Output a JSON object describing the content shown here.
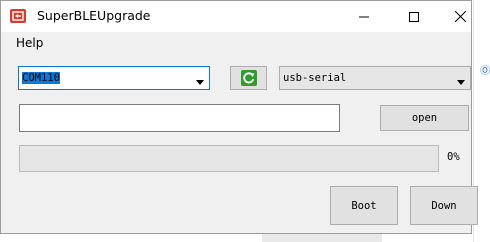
{
  "window": {
    "title": "SuperBLEUpgrade",
    "icon": "app-logo-icon",
    "controls": [
      "minimize-icon",
      "maximize-icon",
      "close-icon"
    ]
  },
  "menu": {
    "items": [
      {
        "label": "Help"
      }
    ]
  },
  "port": {
    "selected": "COM110",
    "icon": "chevron-down-icon"
  },
  "refresh": {
    "icon": "refresh-icon",
    "color": "#2e9d2e"
  },
  "mode": {
    "selected": "usb-serial",
    "icon": "chevron-down-icon"
  },
  "file": {
    "value": "",
    "open_label": "open"
  },
  "progress": {
    "value": 0,
    "text": "0%"
  },
  "actions": {
    "boot_label": "Boot",
    "down_label": "Down"
  },
  "colors": {
    "accent": "#0a78d7",
    "window_bg": "#f0f0f0",
    "icon_red": "#d83a2d"
  }
}
